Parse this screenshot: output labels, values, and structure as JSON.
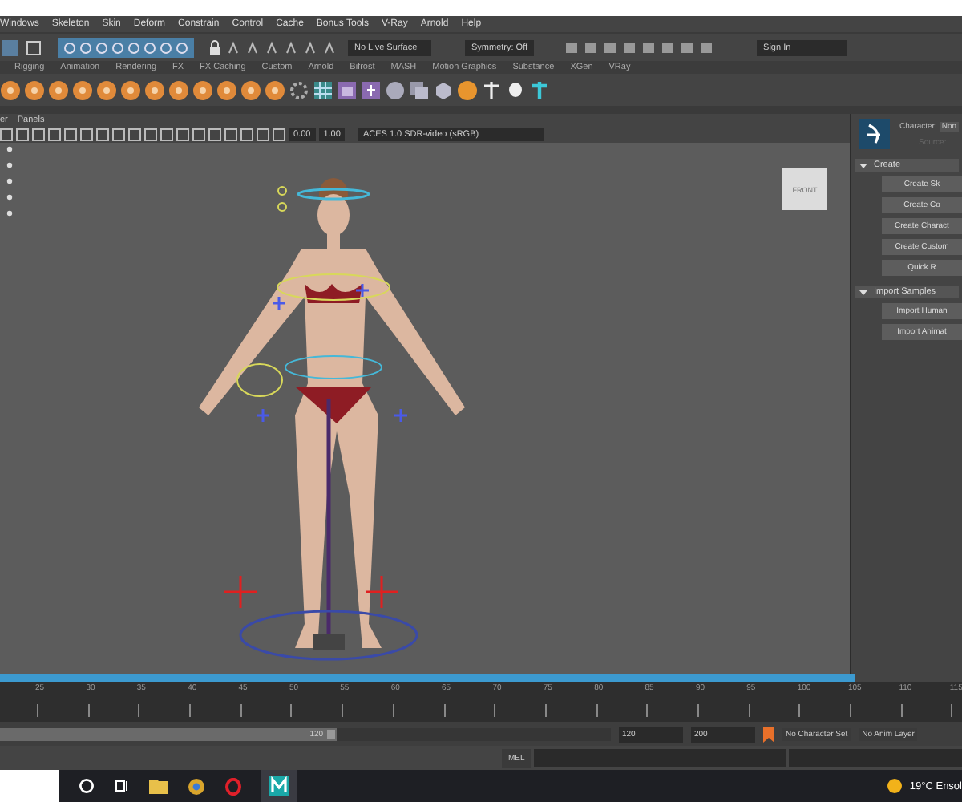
{
  "menu_bar": [
    "Windows",
    "Skeleton",
    "Skin",
    "Deform",
    "Constrain",
    "Control",
    "Cache",
    "Bonus Tools",
    "V-Ray",
    "Arnold",
    "Help"
  ],
  "status_line": {
    "live_surface": "No Live Surface",
    "symmetry": "Symmetry: Off",
    "sign_in": "Sign In"
  },
  "shelf_tabs": [
    "Rigging",
    "Animation",
    "Rendering",
    "FX",
    "FX Caching",
    "Custom",
    "Arnold",
    "Bifrost",
    "MASH",
    "Motion Graphics",
    "Substance",
    "XGen",
    "VRay"
  ],
  "panel_menu": [
    "er",
    "Panels"
  ],
  "viewport_toolbar": {
    "exposure": "0.00",
    "gamma": "1.00",
    "color_space": "ACES 1.0 SDR-video (sRGB)"
  },
  "view_cube": "FRONT",
  "character_panel": {
    "character_label": "Character:",
    "character_value": "Non",
    "source_label": "Source:",
    "sections": [
      {
        "title": "Create",
        "expanded": true,
        "buttons": [
          "Create Sk",
          "Create Co",
          "Create Charact",
          "Create Custom",
          "Quick R"
        ]
      },
      {
        "title": "Import Samples",
        "expanded": true,
        "buttons": [
          "Import Human",
          "Import Animat"
        ]
      }
    ]
  },
  "timeline": {
    "ticks": [
      "25",
      "30",
      "35",
      "40",
      "45",
      "50",
      "55",
      "60",
      "65",
      "70",
      "75",
      "80",
      "85",
      "90",
      "95",
      "100",
      "105",
      "110",
      "115"
    ]
  },
  "range_slider": {
    "level": 0.55,
    "end": "120",
    "start_field": "120",
    "end_field": "200",
    "character_set": "No Character Set",
    "anim_layer": "No Anim Layer"
  },
  "command_line": {
    "language": "MEL"
  },
  "taskbar": {
    "weather": "19°C Ensol"
  }
}
